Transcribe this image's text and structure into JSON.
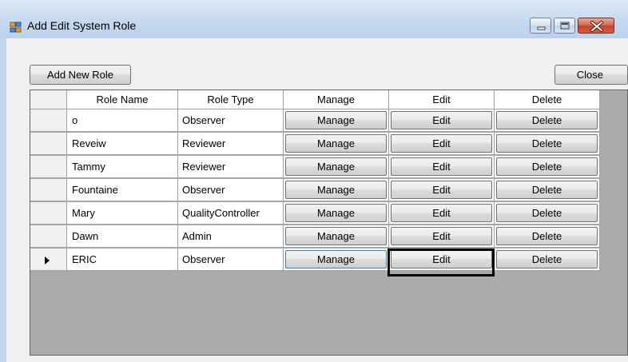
{
  "window": {
    "title": "Add Edit System Role"
  },
  "toolbar": {
    "add_label": "Add New Role",
    "close_label": "Close"
  },
  "grid": {
    "columns": [
      "Role Name",
      "Role Type",
      "Manage",
      "Edit",
      "Delete"
    ],
    "rows": [
      {
        "name": "o",
        "type": "Observer",
        "manage": "Manage",
        "edit": "Edit",
        "delete": "Delete"
      },
      {
        "name": "Reveiw",
        "type": "Reviewer",
        "manage": "Manage",
        "edit": "Edit",
        "delete": "Delete"
      },
      {
        "name": "Tammy",
        "type": "Reviewer",
        "manage": "Manage",
        "edit": "Edit",
        "delete": "Delete"
      },
      {
        "name": "Fountaine",
        "type": "Observer",
        "manage": "Manage",
        "edit": "Edit",
        "delete": "Delete"
      },
      {
        "name": "Mary",
        "type": "QualityController",
        "manage": "Manage",
        "edit": "Edit",
        "delete": "Delete"
      },
      {
        "name": "Dawn",
        "type": "Admin",
        "manage": "Manage",
        "edit": "Edit",
        "delete": "Delete"
      },
      {
        "name": "ERIC",
        "type": "Observer",
        "manage": "Manage",
        "edit": "Edit",
        "delete": "Delete"
      }
    ],
    "current_row_index": 6
  },
  "icons": {
    "app": "app-window-icon",
    "minimize": "minimize-icon",
    "maximize": "maximize-icon",
    "close": "close-icon",
    "row_indicator": "current-row-arrow-icon"
  }
}
